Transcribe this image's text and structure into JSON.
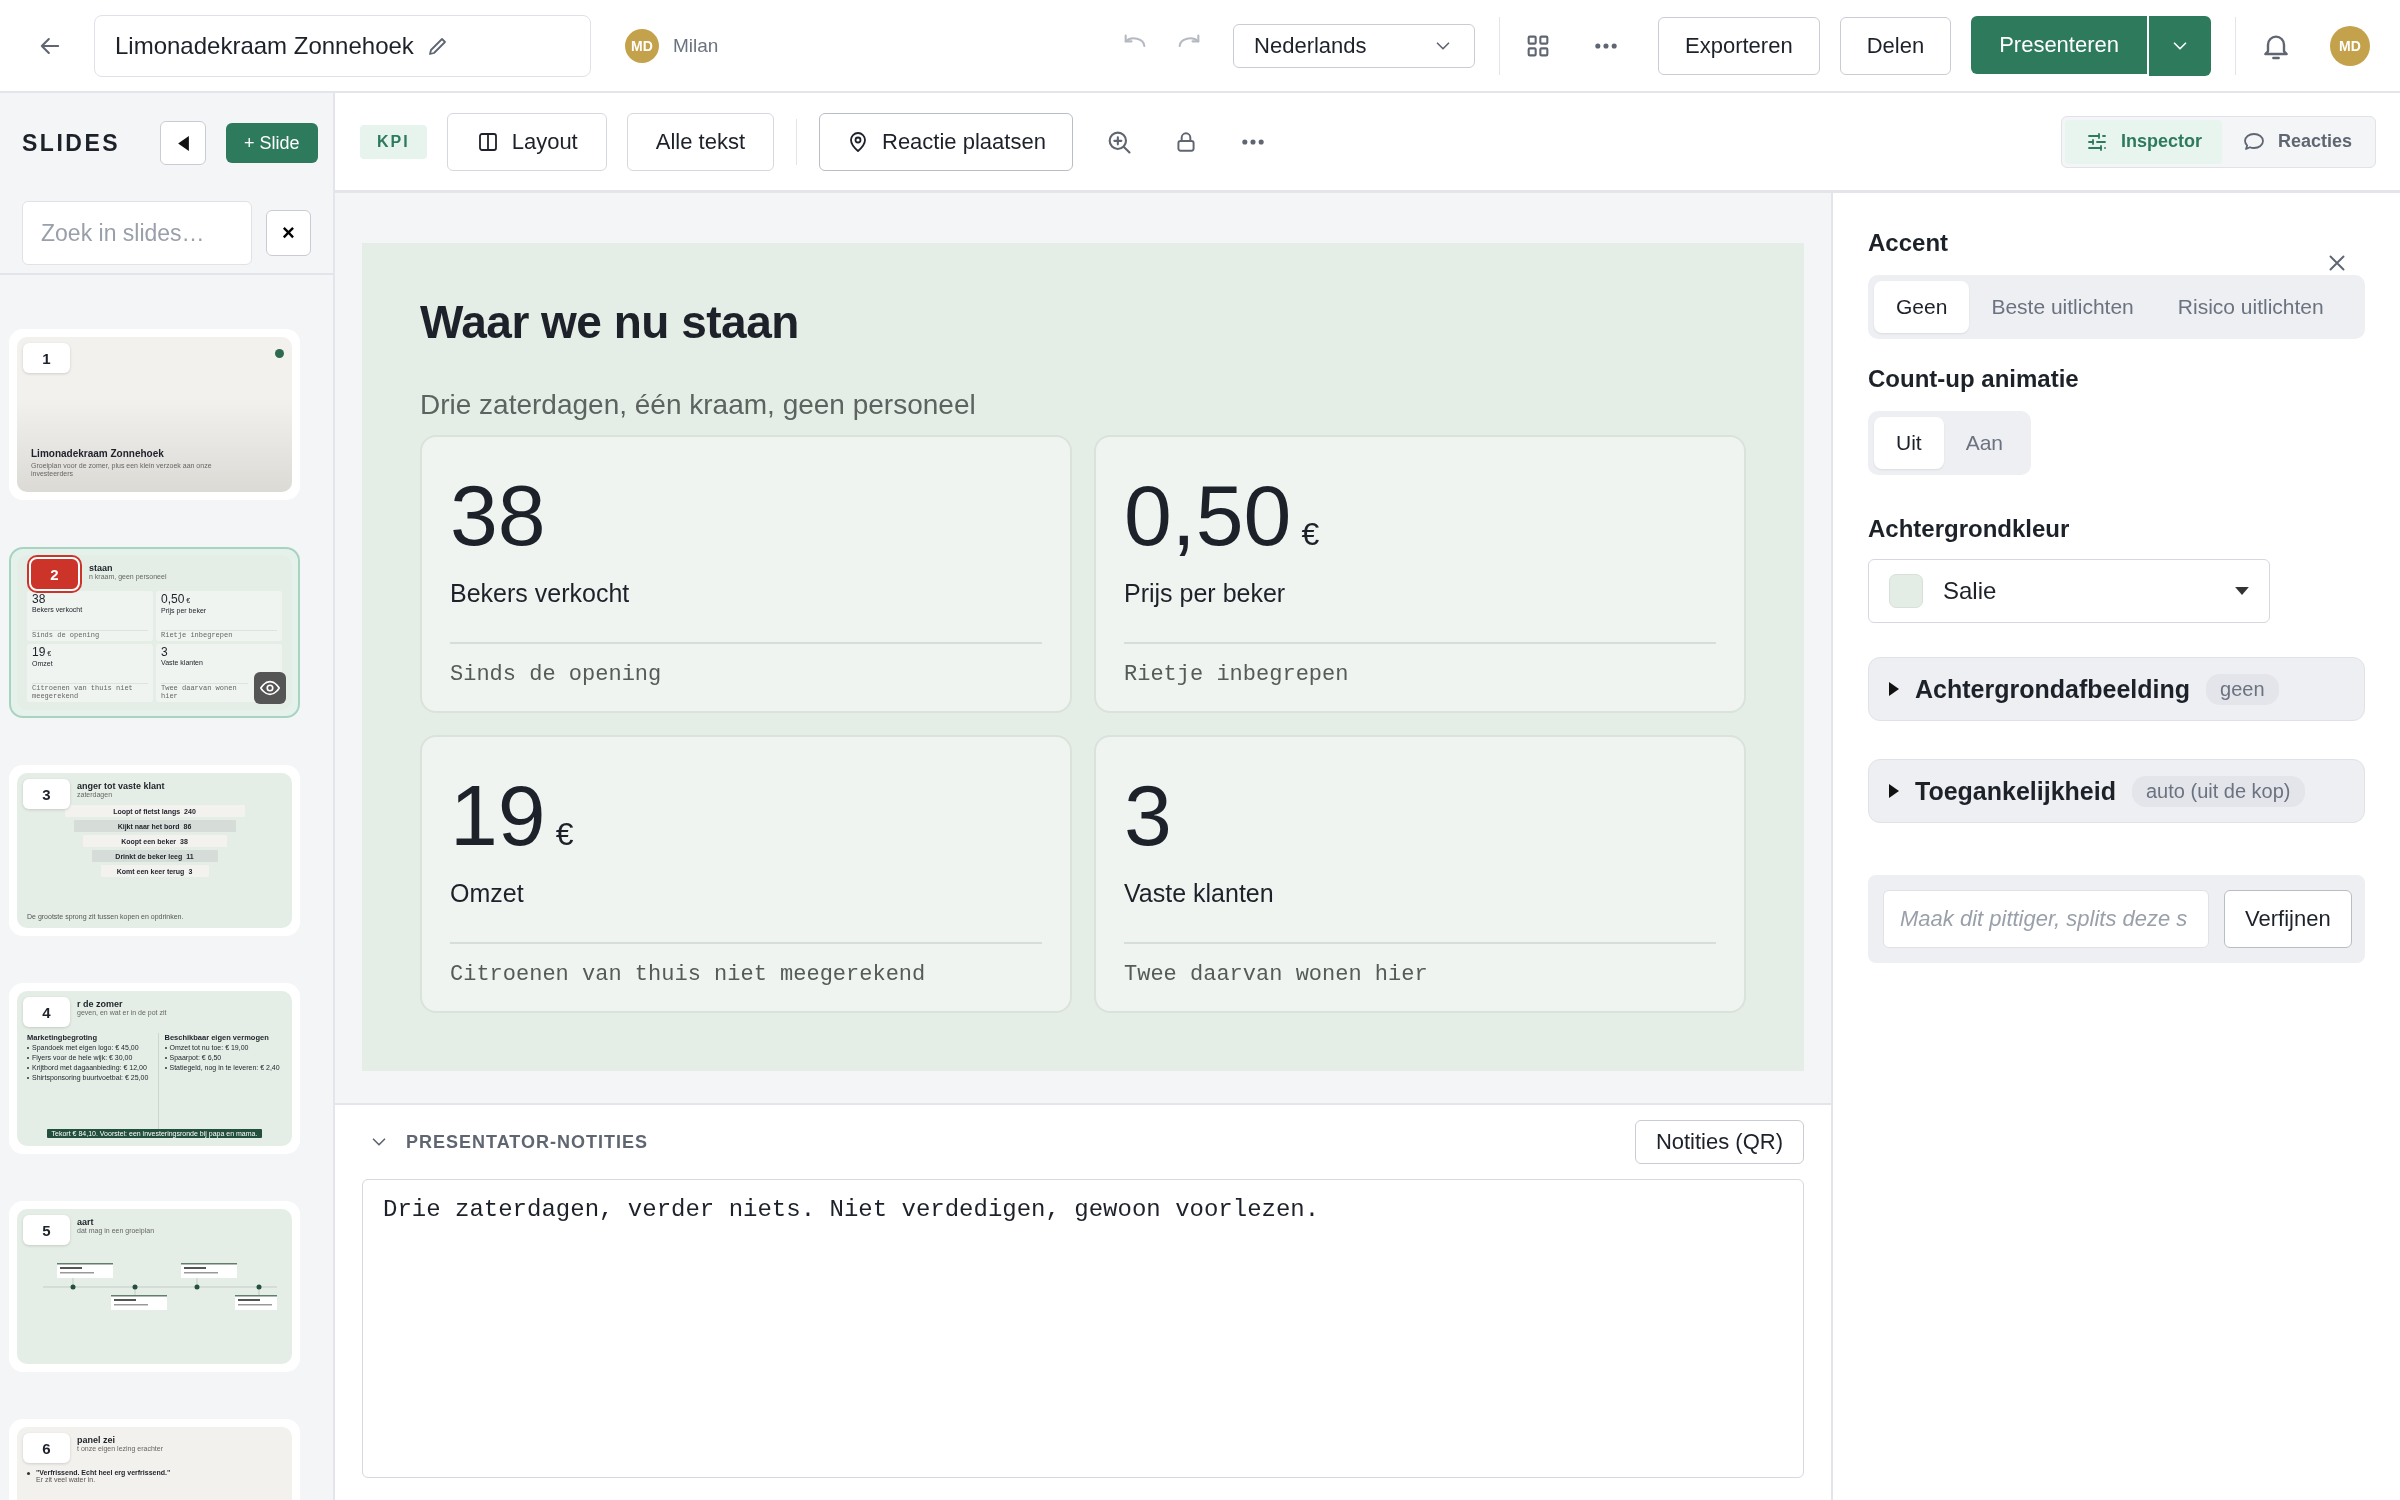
{
  "topbar": {
    "doc_title": "Limonadekraam Zonnehoek",
    "user": {
      "initials": "MD",
      "name": "Milan"
    },
    "language": "Nederlands",
    "buttons": [
      "Exporteren",
      "Delen"
    ],
    "present": "Presenteren",
    "avatar": "MD"
  },
  "sidebar": {
    "heading": "SLIDES",
    "add_button": "+ Slide",
    "search": {
      "placeholder": "Zoek in slides…"
    },
    "clear": "×",
    "slides": [
      {
        "number": "1",
        "kind": "title",
        "selected": false,
        "title": "Limonadekraam Zonnehoek",
        "subtitle": "Groeiplan voor de zomer, plus een klein verzoek aan onze investeerders"
      },
      {
        "number": "2",
        "kind": "kpi",
        "selected": true,
        "title": "staan",
        "subtitle": "n kraam, geen personeel",
        "cards": [
          {
            "value": "38",
            "label": "Bekers verkocht",
            "note": "Sinds de opening"
          },
          {
            "value": "0,50",
            "unit": "€",
            "label": "Prijs per beker",
            "note": "Rietje inbegrepen"
          },
          {
            "value": "19",
            "unit": "€",
            "label": "Omzet",
            "note": "Citroenen van thuis niet meegerekend"
          },
          {
            "value": "3",
            "label": "Vaste klanten",
            "note": "Twee daarvan wonen hier"
          }
        ]
      },
      {
        "number": "3",
        "kind": "funnel",
        "selected": false,
        "title": "anger tot vaste klant",
        "subtitle": "zaterdagen",
        "steps": [
          {
            "label": "Loopt of fietst langs",
            "value": "240"
          },
          {
            "label": "Kijkt naar het bord",
            "value": "86"
          },
          {
            "label": "Koopt een beker",
            "value": "38"
          },
          {
            "label": "Drinkt de beker leeg",
            "value": "11"
          },
          {
            "label": "Komt een keer terug",
            "value": "3"
          }
        ],
        "footer": "De grootste sprong zit tussen kopen en opdrinken."
      },
      {
        "number": "4",
        "kind": "columns",
        "selected": false,
        "title": "r de zomer",
        "subtitle": "geven, en wat er in de pot zit",
        "columns": [
          {
            "heading": "Marketingbegroting",
            "items": [
              "Spandoek met eigen logo: € 45,00",
              "Flyers voor de hele wijk: € 30,00",
              "Krijtbord met dagaanbieding: € 12,00",
              "Shirtsponsoring buurtvoetbal: € 25,00"
            ]
          },
          {
            "heading": "Beschikbaar eigen vermogen",
            "items": [
              "Omzet tot nu toe: € 19,00",
              "Spaarpot: € 6,50",
              "Statiegeld, nog in te leveren: € 2,40"
            ]
          }
        ],
        "footer": "Tekort € 84,10. Voorstel: een investeringsronde bij papa en mama."
      },
      {
        "number": "5",
        "kind": "timeline",
        "selected": false,
        "title": "aart",
        "subtitle": "dat mag in een groeiplan"
      },
      {
        "number": "6",
        "kind": "quotes",
        "selected": false,
        "title": "panel zei",
        "subtitle": "t onze eigen lezing erachter",
        "quote": "\"Verfrissend. Echt heel erg verfrissend.\"",
        "quote_note": "Er zit veel water in."
      }
    ]
  },
  "toolbar": {
    "layout_tag": "KPI",
    "buttons": [
      "Layout",
      "Alle tekst"
    ],
    "comment_button": "Reactie plaatsen",
    "panel_tabs": [
      {
        "label": "Inspector",
        "selected": true
      },
      {
        "label": "Reacties",
        "selected": false
      }
    ]
  },
  "slide": {
    "title": "Waar we nu staan",
    "subtitle": "Drie zaterdagen, één kraam, geen personeel",
    "cards": [
      {
        "value": "38",
        "label": "Bekers verkocht",
        "note": "Sinds de opening"
      },
      {
        "value": "0,50",
        "unit": "€",
        "label": "Prijs per beker",
        "note": "Rietje inbegrepen"
      },
      {
        "value": "19",
        "unit": "€",
        "label": "Omzet",
        "note": "Citroenen van thuis niet meegerekend"
      },
      {
        "value": "3",
        "label": "Vaste klanten",
        "note": "Twee daarvan wonen hier"
      }
    ]
  },
  "notes": {
    "heading": "PRESENTATOR-NOTITIES",
    "expanded": true,
    "qr_button": "Notities (QR)",
    "text": "Drie zaterdagen, verder niets. Niet verdedigen, gewoon voorlezen."
  },
  "inspector": {
    "accent": {
      "label": "Accent",
      "options": [
        {
          "label": "Geen",
          "selected": true
        },
        {
          "label": "Beste uitlichten",
          "selected": false
        },
        {
          "label": "Risico uitlichten",
          "selected": false
        }
      ]
    },
    "countup": {
      "label": "Count-up animatie",
      "options": [
        {
          "label": "Uit",
          "selected": true
        },
        {
          "label": "Aan",
          "selected": false
        }
      ]
    },
    "background": {
      "label": "Achtergrondkleur",
      "value": "Salie"
    },
    "sections": [
      {
        "title": "Achtergrondafbeelding",
        "badge": "geen",
        "expanded": false
      },
      {
        "title": "Toegankelijkheid",
        "badge": "auto (uit de kop)",
        "expanded": false
      }
    ],
    "refine": {
      "placeholder": "Maak dit pittiger, splits deze s",
      "button": "Verfijnen"
    }
  }
}
